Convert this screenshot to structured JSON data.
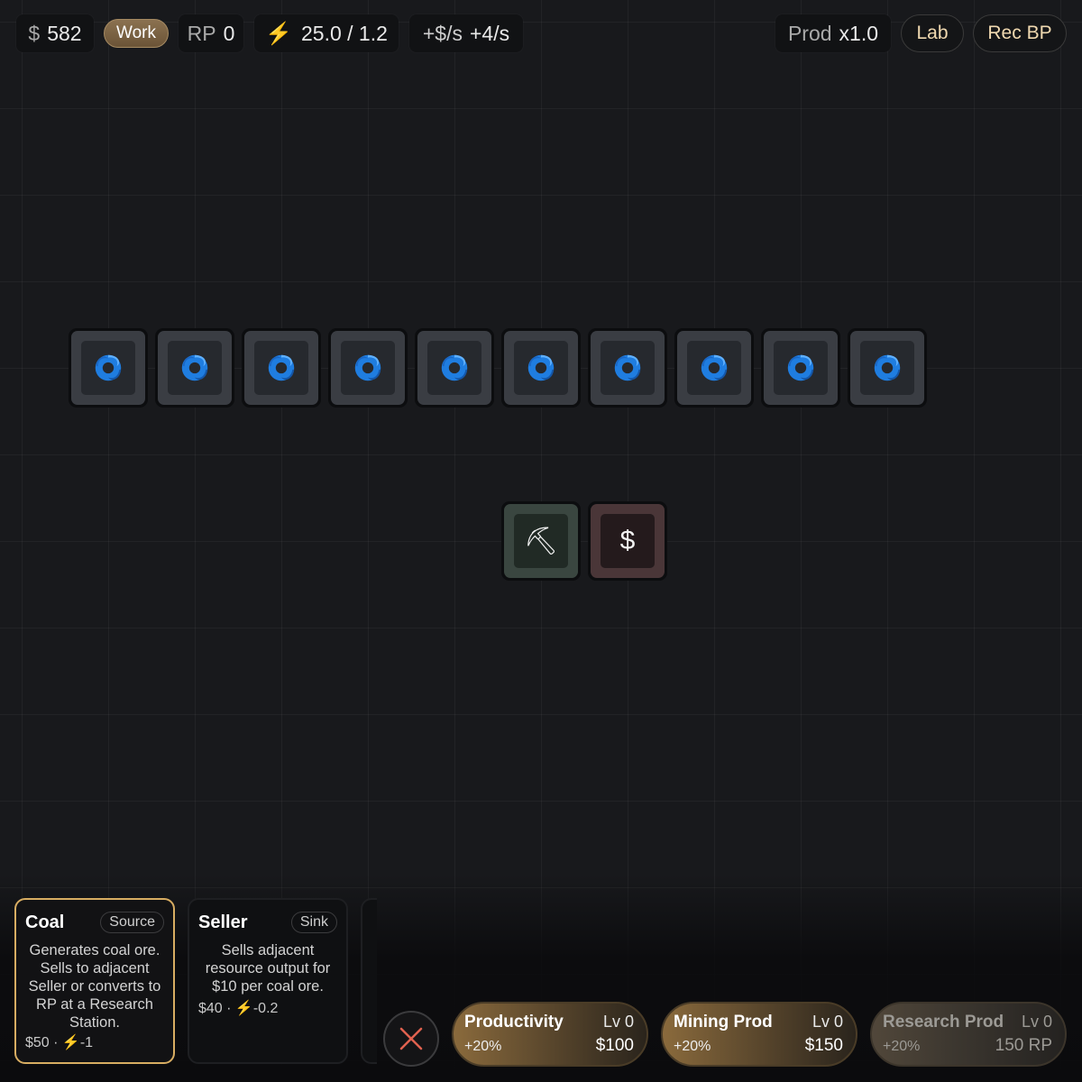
{
  "topbar": {
    "money_symbol": "$",
    "money_value": "582",
    "work_label": "Work",
    "rp_label": "RP",
    "rp_value": "0",
    "power_value": "25.0 / 1.2",
    "income_label": "+$/s",
    "income_value": "+4/s",
    "prod_label": "Prod",
    "prod_value": "x1.0",
    "lab_label": "Lab",
    "rec_bp_label": "Rec BP"
  },
  "board": {
    "generator_row_icon": "swirl-icon",
    "generator_count": 10,
    "miner_icon_glyph": "⛏",
    "seller_icon_glyph": "$"
  },
  "cards": [
    {
      "title": "Coal",
      "tag": "Source",
      "desc": "Generates coal ore. Sells to adjacent Seller or converts to RP at a Research Station.",
      "cost": "$50 · ",
      "power": "-1",
      "selected": true
    },
    {
      "title": "Seller",
      "tag": "Sink",
      "desc": "Sells adjacent resource output for $10 per coal ore.",
      "cost": "$40 · ",
      "power": "-0.2",
      "selected": false
    }
  ],
  "upgrades": [
    {
      "name": "Productivity",
      "level": "Lv 0",
      "bonus": "+20%",
      "price": "$100",
      "enabled": true
    },
    {
      "name": "Mining Prod",
      "level": "Lv 0",
      "bonus": "+20%",
      "price": "$150",
      "enabled": true
    },
    {
      "name": "Research Prod",
      "level": "Lv 0",
      "bonus": "+20%",
      "price": "150 RP",
      "enabled": false
    }
  ],
  "colors": {
    "accent_gold": "#d8ad62",
    "bolt_yellow": "#f3c13d",
    "swirl_blue": "#1f7de0",
    "close_red": "#e0614f"
  }
}
